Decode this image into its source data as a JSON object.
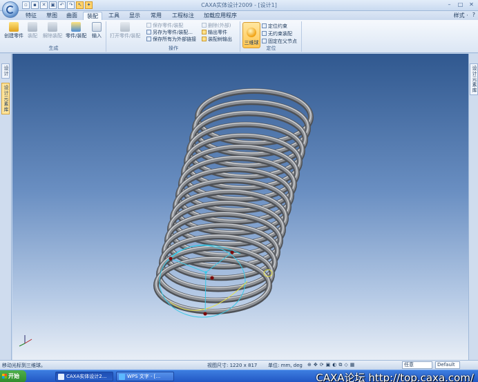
{
  "title_bar": {
    "title": "CAXA实体设计2009 - [设计1]",
    "quick_access": [
      "new-icon",
      "open-icon",
      "close-icon",
      "save-icon",
      "undo-icon",
      "redo-icon",
      "select-icon",
      "tool-icon"
    ]
  },
  "tabs": [
    "特征",
    "草图",
    "曲面",
    "装配",
    "工具",
    "显示",
    "常用",
    "工程标注",
    "加载应用程序"
  ],
  "active_tab": "装配",
  "right_menu": {
    "style": "样式 ·",
    "help": "?"
  },
  "ribbon": {
    "group_generate": {
      "label": "生成",
      "buttons": [
        "创建零件",
        "装配",
        "解除装配",
        "零件/装配",
        "输入"
      ]
    },
    "group_operate": {
      "label": "操作",
      "open_button": "打开零件/装配",
      "small": [
        "保存零件/装配",
        "另存为零件/装配...",
        "保存所有为外部链接",
        "删除(外部)",
        "输出零件",
        "装配树输出"
      ]
    },
    "group_position": {
      "label": "定位",
      "ball_button": "三维球",
      "small": [
        "定位约束",
        "无约束装配",
        "固定在父节点"
      ]
    }
  },
  "left_panel_tabs": [
    "设计",
    "设计元素库"
  ],
  "right_panel_tabs": [
    "设计元素库"
  ],
  "status": {
    "message": "移动光标到三维球。",
    "view_size": "视图尺寸: 1220 x 817",
    "units": "单位: mm, deg",
    "mode_combo": "任意",
    "style_combo": "Default"
  },
  "taskbar": {
    "start": "开始",
    "items": [
      "CAXA实体设计2...",
      "WPS 文字 - [..."
    ]
  },
  "watermark": "CAXA论坛 http://top.caxa.com/",
  "colors": {
    "viewport_top": "#30588f",
    "viewport_bottom": "#e8eef6",
    "spring": "#8c8f94",
    "ball_handle": "#7a0a0a",
    "guide_cyan": "#38c8e6",
    "guide_yellow": "#e6e24a"
  }
}
